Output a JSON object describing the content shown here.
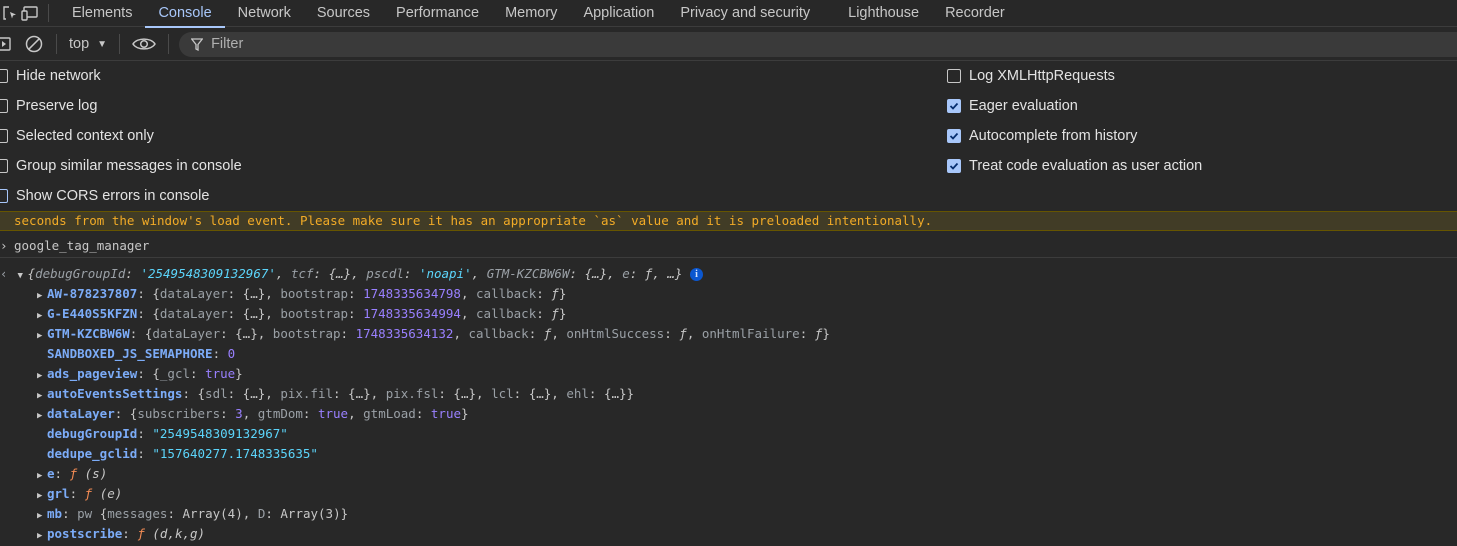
{
  "tabs": [
    {
      "label": "Elements"
    },
    {
      "label": "Console"
    },
    {
      "label": "Network"
    },
    {
      "label": "Sources"
    },
    {
      "label": "Performance"
    },
    {
      "label": "Memory"
    },
    {
      "label": "Application"
    },
    {
      "label": "Privacy and security"
    },
    {
      "label": "Lighthouse"
    },
    {
      "label": "Recorder"
    }
  ],
  "active_tab": "Console",
  "toolbar": {
    "context": "top",
    "filter_placeholder": "Filter"
  },
  "settings": {
    "left": [
      {
        "label": "Hide network",
        "checked": false
      },
      {
        "label": "Preserve log",
        "checked": false
      },
      {
        "label": "Selected context only",
        "checked": false
      },
      {
        "label": "Group similar messages in console",
        "checked": false
      },
      {
        "label": "Show CORS errors in console",
        "checked": false
      }
    ],
    "right": [
      {
        "label": "Log XMLHttpRequests",
        "checked": false
      },
      {
        "label": "Eager evaluation",
        "checked": true
      },
      {
        "label": "Autocomplete from history",
        "checked": true
      },
      {
        "label": "Treat code evaluation as user action",
        "checked": true
      }
    ]
  },
  "warning_text": "seconds from the window's load event. Please make sure it has an appropriate `as` value and it is preloaded intentionally.",
  "console": {
    "input": "google_tag_manager",
    "summary": {
      "k1": "debugGroupId",
      "v1": "'2549548309132967'",
      "k2": "tcf",
      "v2": "{…}",
      "k3": "pscdl",
      "v3": "'noapi'",
      "k4": "GTM-KZCBW6W",
      "v4": "{…}",
      "k5": "e",
      "v5": "ƒ",
      "tail": "…}"
    },
    "entries": {
      "aw": {
        "key": "AW-878237807",
        "bootstrap": "1748335634798"
      },
      "g": {
        "key": "G-E440S5KFZN",
        "bootstrap": "1748335634994"
      },
      "gtm": {
        "key": "GTM-KZCBW6W",
        "bootstrap": "1748335634132"
      },
      "sandboxed": {
        "key": "SANDBOXED_JS_SEMAPHORE",
        "value": "0"
      },
      "ads": {
        "key": "ads_pageview",
        "sub": "_gcl",
        "value": "true"
      },
      "auto": {
        "key": "autoEventsSettings"
      },
      "datalayer": {
        "key": "dataLayer",
        "subscribers": "3",
        "gtmDom": "true",
        "gtmLoad": "true"
      },
      "debug": {
        "key": "debugGroupId",
        "value": "\"2549548309132967\""
      },
      "dedupe": {
        "key": "dedupe_gclid",
        "value": "\"157640277.1748335635\""
      },
      "e": {
        "key": "e",
        "sig": "(s)"
      },
      "grl": {
        "key": "grl",
        "sig": "(e)"
      },
      "mb": {
        "key": "mb",
        "cls": "pw",
        "messages": "Array(4)",
        "D": "Array(3)"
      },
      "postscribe": {
        "key": "postscribe",
        "sig": "(d,k,g)"
      }
    }
  }
}
